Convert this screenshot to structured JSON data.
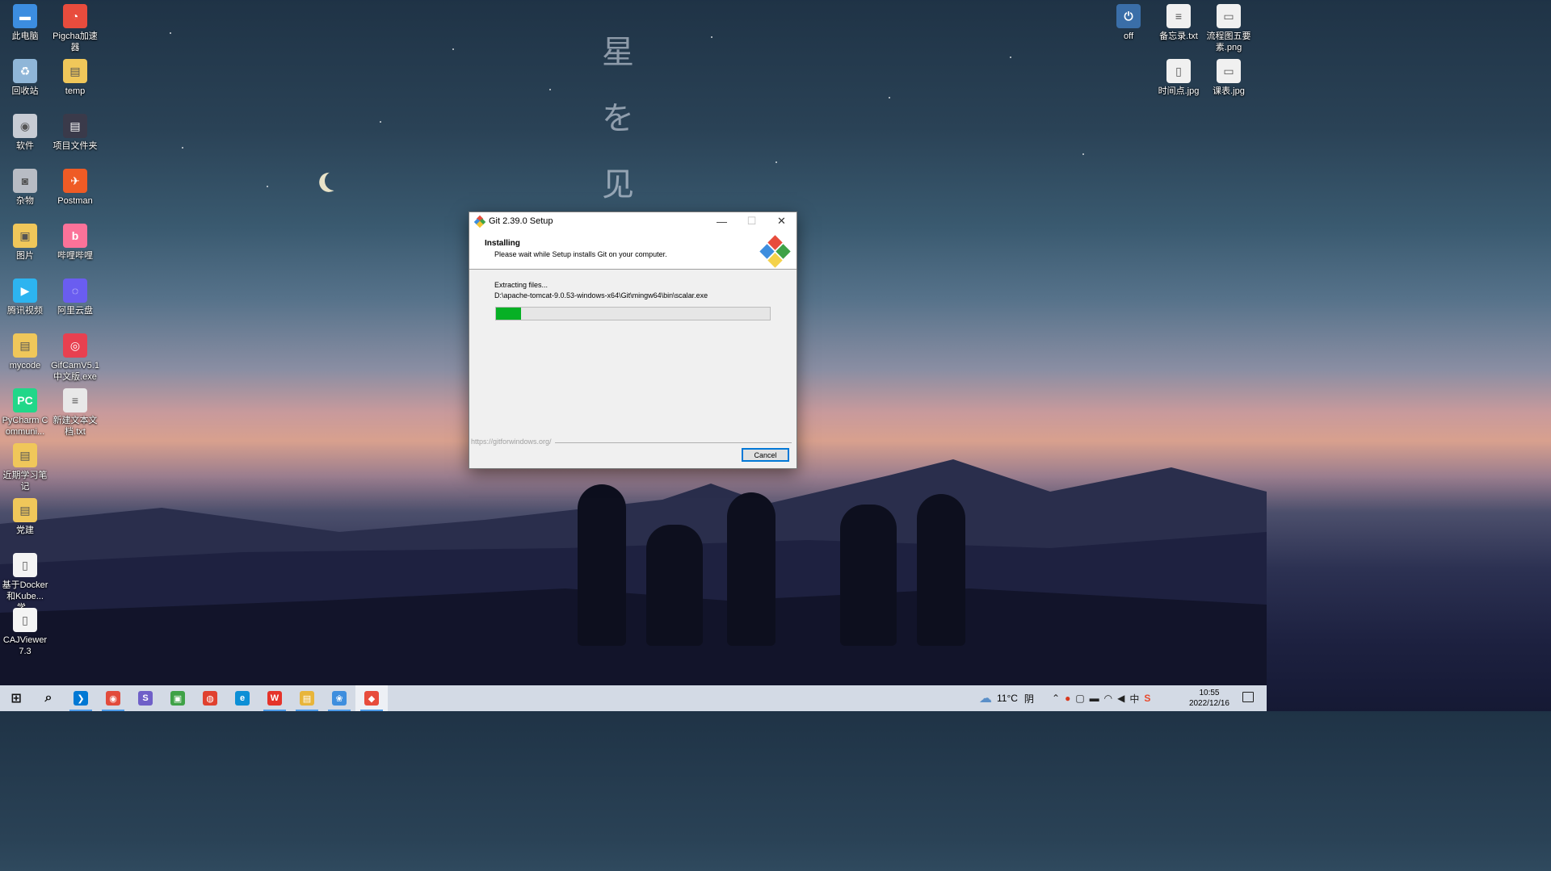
{
  "wallpaper": {
    "vertical_text": [
      "星",
      "を",
      "见"
    ]
  },
  "desktop_icons_left": [
    {
      "label": "此电脑",
      "icon": "computer-icon",
      "color": "#3c8de0",
      "glyph": "▬"
    },
    {
      "label": "Pigcha加速器",
      "icon": "pigcha-icon",
      "color": "#e84c3d",
      "glyph": "◔"
    },
    {
      "label": "回收站",
      "icon": "recycle-bin-icon",
      "color": "#8fb6d8",
      "glyph": "♻"
    },
    {
      "label": "temp",
      "icon": "folder-icon",
      "color": "#f0c75a",
      "glyph": "▤"
    },
    {
      "label": "软件",
      "icon": "dvd-drive-icon",
      "color": "#c8ccd4",
      "glyph": "◉"
    },
    {
      "label": "项目文件夹",
      "icon": "folder-icon",
      "color": "#3a3a4a",
      "glyph": "▤"
    },
    {
      "label": "杂物",
      "icon": "drive-icon",
      "color": "#b8bcc4",
      "glyph": "◙"
    },
    {
      "label": "Postman",
      "icon": "postman-icon",
      "color": "#ef5b25",
      "glyph": "✈"
    },
    {
      "label": "图片",
      "icon": "pictures-folder-icon",
      "color": "#f0c75a",
      "glyph": "▣"
    },
    {
      "label": "哔哩哔哩",
      "icon": "bilibili-icon",
      "color": "#fb7299",
      "glyph": "b"
    },
    {
      "label": "腾讯视频",
      "icon": "tencent-video-icon",
      "color": "#2db4f0",
      "glyph": "▶"
    },
    {
      "label": "阿里云盘",
      "icon": "aliyun-drive-icon",
      "color": "#6a5df0",
      "glyph": "◌"
    },
    {
      "label": "mycode",
      "icon": "folder-icon",
      "color": "#f0c75a",
      "glyph": "▤"
    },
    {
      "label": "GifCamV5.1中文版.exe",
      "icon": "gifcam-icon",
      "color": "#e84050",
      "glyph": "◎"
    },
    {
      "label": "PyCharm Communi...",
      "icon": "pycharm-icon",
      "color": "#21d789",
      "glyph": "PC"
    },
    {
      "label": "新建文本文档.txt",
      "icon": "text-file-icon",
      "color": "#e8e8e8",
      "glyph": "≡"
    },
    {
      "label": "近期学习笔记",
      "icon": "folder-icon",
      "color": "#f0c75a",
      "glyph": "▤"
    },
    {
      "label": "党建",
      "icon": "folder-icon",
      "color": "#f0c75a",
      "glyph": "▤"
    },
    {
      "label": "基于Docker和Kube...学...",
      "icon": "document-icon",
      "color": "#f4f4f4",
      "glyph": "▯"
    },
    {
      "label": "CAJViewer 7.3",
      "icon": "document-icon",
      "color": "#f4f4f4",
      "glyph": "▯"
    }
  ],
  "desktop_icons_right": [
    {
      "label": "off",
      "icon": "power-icon",
      "color": "#3a6ea8",
      "glyph": "⏻"
    },
    {
      "label": "备忘录.txt",
      "icon": "text-file-icon",
      "color": "#f0f0f0",
      "glyph": "≡"
    },
    {
      "label": "流程图五要素.png",
      "icon": "image-file-icon",
      "color": "#f0f0f0",
      "glyph": "▭"
    },
    {
      "label": "时间点.jpg",
      "icon": "image-file-icon",
      "color": "#f0f0f0",
      "glyph": "▯"
    },
    {
      "label": "课表.jpg",
      "icon": "image-file-icon",
      "color": "#f0f0f0",
      "glyph": "▭"
    }
  ],
  "dialog": {
    "title": "Git 2.39.0 Setup",
    "heading": "Installing",
    "subheading": "Please wait while Setup installs Git on your computer.",
    "status": "Extracting files...",
    "current_file": "D:\\apache-tomcat-9.0.53-windows-x64\\Git\\mingw64\\bin\\scalar.exe",
    "progress": 0.09,
    "footer_url": "https://gitforwindows.org/",
    "cancel_label": "Cancel",
    "minimize_glyph": "—",
    "maximize_glyph": "☐",
    "close_glyph": "✕"
  },
  "taskbar": {
    "apps": [
      {
        "name": "start",
        "icon": "windows-start-icon",
        "glyph": "⊞",
        "color": "#000"
      },
      {
        "name": "search",
        "icon": "search-icon",
        "glyph": "⌕",
        "color": "#000"
      },
      {
        "name": "vscode",
        "icon": "vscode-icon",
        "glyph": "❯",
        "color": "#0078d4"
      },
      {
        "name": "chrome",
        "icon": "chrome-icon",
        "glyph": "◉",
        "color": "#e24b3b"
      },
      {
        "name": "app-s",
        "icon": "s-app-icon",
        "glyph": "S",
        "color": "#6f5fc8"
      },
      {
        "name": "app-green",
        "icon": "gallery-app-icon",
        "glyph": "▣",
        "color": "#3fa247"
      },
      {
        "name": "app-red",
        "icon": "swirl-app-icon",
        "glyph": "◍",
        "color": "#e0412f"
      },
      {
        "name": "edge",
        "icon": "edge-icon",
        "glyph": "e",
        "color": "#0c8fd6"
      },
      {
        "name": "wps",
        "icon": "wps-icon",
        "glyph": "W",
        "color": "#e5332a"
      },
      {
        "name": "explorer",
        "icon": "file-explorer-icon",
        "glyph": "▤",
        "color": "#e8b53a"
      },
      {
        "name": "app-blue",
        "icon": "network-app-icon",
        "glyph": "❀",
        "color": "#3e8ede"
      },
      {
        "name": "git-setup",
        "icon": "git-icon",
        "glyph": "◆",
        "color": "#e74c3c"
      }
    ],
    "weather_temp": "11°C",
    "weather_desc": "阴",
    "time": "10:55",
    "date": "2022/12/16",
    "ime": "中",
    "sogou": "S"
  }
}
